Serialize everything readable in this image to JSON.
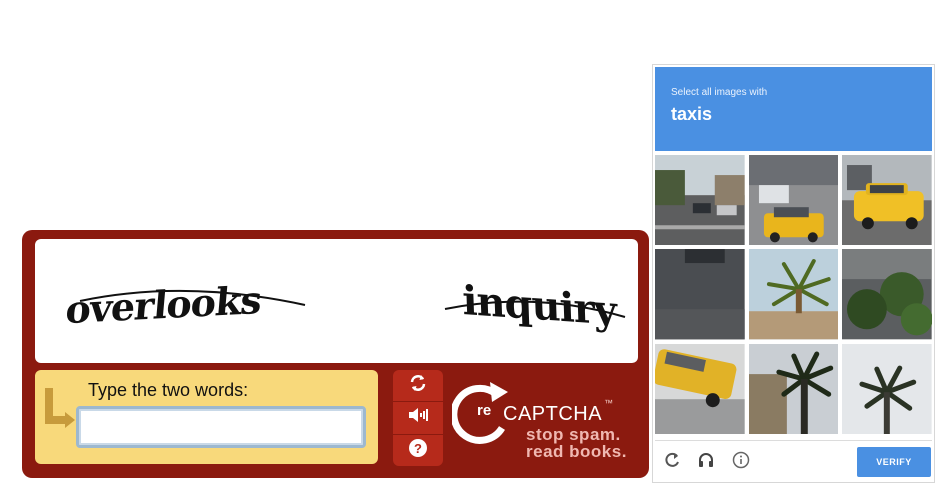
{
  "classic_captcha": {
    "words": [
      "overlooks",
      "inquiry"
    ],
    "prompt": "Type the two words:",
    "input_value": "",
    "tools": [
      "refresh-icon",
      "audio-icon",
      "help-icon"
    ],
    "brand": {
      "prefix": "re",
      "name": "CAPTCHA",
      "trademark": "™",
      "tagline_line1": "stop spam.",
      "tagline_line2": "read books."
    },
    "colors": {
      "frame": "#8b1a0f",
      "input_panel": "#f8d97b",
      "tool_buttons": "#b62a1b"
    }
  },
  "image_captcha": {
    "instruction": "Select all images with",
    "target": "taxis",
    "tiles": [
      "street-with-cars",
      "street-with-taxi",
      "taxi-closeup",
      "road-asphalt",
      "palm-tree",
      "shrubs",
      "taxi-on-street",
      "palm-tree-building",
      "palm-tree-sky"
    ],
    "footer_icons": [
      "reload-icon",
      "headphones-icon",
      "info-icon"
    ],
    "verify_label": "VERIFY",
    "colors": {
      "header": "#4a90e2",
      "verify": "#4a90e2"
    }
  }
}
